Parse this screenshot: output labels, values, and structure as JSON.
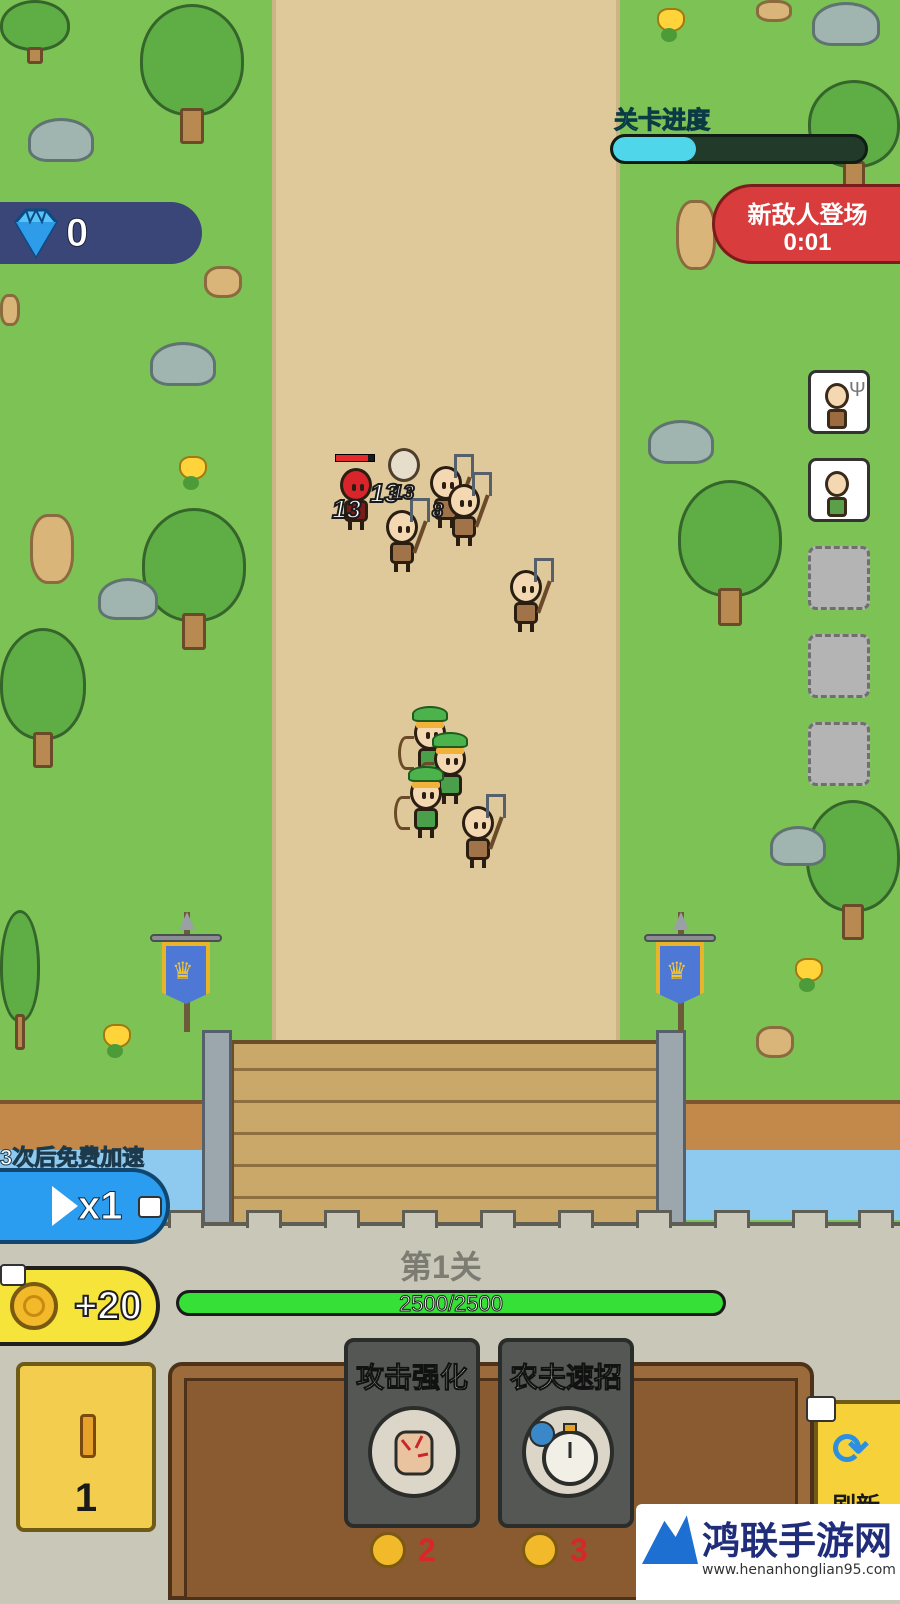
{
  "hud": {
    "gems": "0",
    "level_progress_label": "关卡进度",
    "level_progress": 0.33,
    "new_enemy_title": "新敌人登场",
    "new_enemy_timer": "0:01"
  },
  "battle": {
    "damage_numbers": [
      "13",
      "13",
      "13",
      "8"
    ],
    "enemy_hp": 0.85
  },
  "unit_slots": [
    {
      "state": "filled",
      "unit": "farmer-pitchfork"
    },
    {
      "state": "filled",
      "unit": "farmer-sickle"
    },
    {
      "state": "empty"
    },
    {
      "state": "empty"
    },
    {
      "state": "empty"
    }
  ],
  "bottom": {
    "speed_tip": "3次后免费加速",
    "speed_label": "x1",
    "coin_bonus": "+20",
    "level_name": "第1关",
    "castle_hp_text": "2500/2500",
    "castle_hp": 1.0,
    "wave_number": "1",
    "cards": [
      {
        "title": "攻击强化",
        "icon": "fist-icon",
        "cost": "2"
      },
      {
        "title": "农夫速招",
        "icon": "stopwatch-icon",
        "cost": "3"
      }
    ],
    "refresh_label": "刷新"
  },
  "watermark": {
    "title": "鸿联手游网",
    "url": "www.henanhonglian95.com"
  },
  "colors": {
    "grass": "#7cc255",
    "road": "#dfc99b",
    "progress": "#4fd6ea",
    "hp": "#36e037",
    "alert": "#d93c3c",
    "speed_button": "#2a9df0",
    "coin_button": "#f6e43a"
  }
}
